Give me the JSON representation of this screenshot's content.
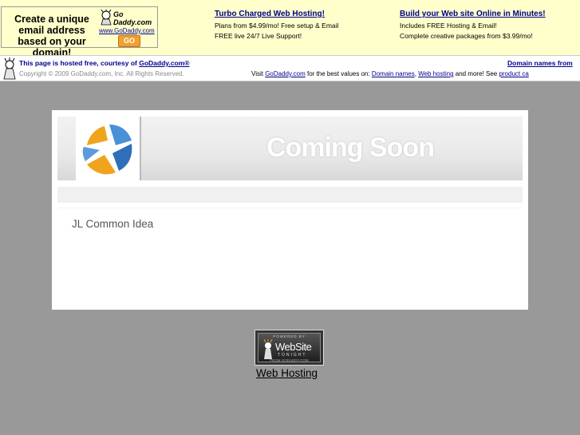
{
  "ad": {
    "box_text": "Create a unique email address based on your domain!",
    "logo_name": "Go Daddy.com",
    "logo_url": "www.GoDaddy.com",
    "go_label": "GO"
  },
  "promos": [
    {
      "headline": "Turbo Charged Web Hosting!",
      "line1": "Plans from $4.99/mo! Free setup & Email",
      "line2": "FREE live 24/7 Live Support!"
    },
    {
      "headline": "Build your Web site Online in Minutes!",
      "line1": "Includes FREE Hosting & Email!",
      "line2": "Complete creative packages from $3.99/mo!"
    }
  ],
  "hosting_bar": {
    "line1_prefix": "This page is hosted free, courtesy of ",
    "line1_link": "GoDaddy.com®",
    "copyright": "Copyright © 2009 GoDaddy.com, Inc. All Rights Reserved.",
    "right_link": "Domain names from",
    "visit_prefix": "Visit ",
    "visit_link": "GoDaddy.com",
    "visit_mid": " for the best values on: ",
    "link_domains": "Domain names",
    "sep1": ", ",
    "link_hosting": "Web hosting",
    "visit_tail": " and more! See ",
    "link_product": "product ca"
  },
  "card": {
    "coming_soon": "Coming Soon",
    "company_name": "JL Common Idea"
  },
  "footer": {
    "badge_powered": "POWERED BY",
    "badge_name": "WebSite",
    "badge_tonight": "TONIGHT",
    "badge_from": "FROM GODADDY.COM",
    "web_hosting_link": "Web Hosting"
  },
  "colors": {
    "page_bg": "#999999",
    "ad_bg": "#ffffcc",
    "link": "#00008b"
  }
}
